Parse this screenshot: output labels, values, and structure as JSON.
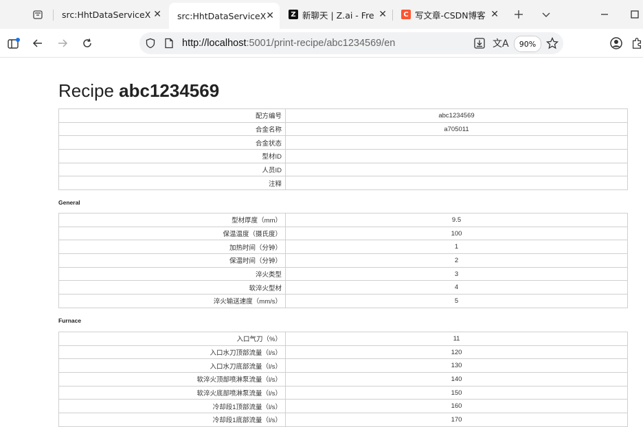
{
  "browser": {
    "tabs": [
      {
        "title": "src:HhtDataServiceX",
        "active": false
      },
      {
        "title": "src:HhtDataServiceX",
        "active": true
      },
      {
        "title": "新聊天 | Z.ai - Free",
        "active": false,
        "favicon": "Z"
      },
      {
        "title": "写文章-CSDN博客",
        "active": false,
        "favicon": "C"
      }
    ],
    "url_host": "http://localhost",
    "url_rest": ":5001/print-recipe/abc1234569/en",
    "zoom": "90%",
    "colors": {
      "csdn": "#fc5531",
      "zai": "#111111",
      "notify": "#1a73e8"
    }
  },
  "page": {
    "title_prefix": "Recipe ",
    "title_id": "abc1234569",
    "header_rows": [
      {
        "label": "配方编号",
        "value": "abc1234569"
      },
      {
        "label": "合金名称",
        "value": "a705011"
      },
      {
        "label": "合金状态",
        "value": ""
      },
      {
        "label": "型材ID",
        "value": ""
      },
      {
        "label": "人员ID",
        "value": ""
      },
      {
        "label": "注释",
        "value": ""
      }
    ],
    "sections": [
      {
        "name": "General",
        "rows": [
          {
            "label": "型材厚度（mm）",
            "value": "9.5"
          },
          {
            "label": "保温温度（摄氏度）",
            "value": "100"
          },
          {
            "label": "加热时间（分钟）",
            "value": "1"
          },
          {
            "label": "保温时间（分钟）",
            "value": "2"
          },
          {
            "label": "淬火类型",
            "value": "3"
          },
          {
            "label": "软淬火型材",
            "value": "4"
          },
          {
            "label": "淬火输送速度（mm/s）",
            "value": "5"
          }
        ]
      },
      {
        "name": "Furnace",
        "rows": [
          {
            "label": "入口气刀（%）",
            "value": "11"
          },
          {
            "label": "入口水刀顶部流量（l/s）",
            "value": "120"
          },
          {
            "label": "入口水刀底部流量（l/s）",
            "value": "130"
          },
          {
            "label": "软淬火顶部喷淋泵流量（l/s）",
            "value": "140"
          },
          {
            "label": "软淬火底部喷淋泵流量（l/s）",
            "value": "150"
          },
          {
            "label": "冷却段1顶部流量（l/s）",
            "value": "160"
          },
          {
            "label": "冷却段1底部流量（l/s）",
            "value": "170"
          }
        ]
      }
    ]
  }
}
